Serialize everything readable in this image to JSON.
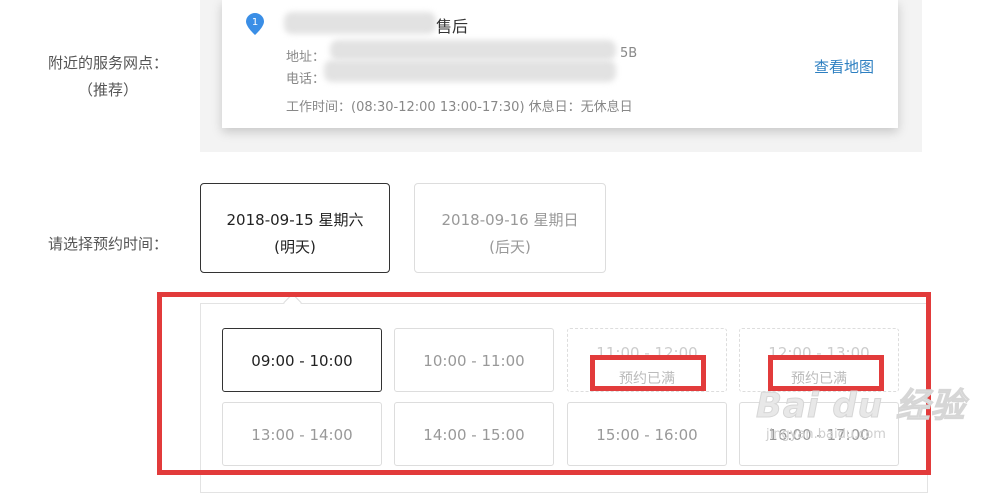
{
  "nearby": {
    "label_line1": "附近的服务网点：",
    "label_line2": "（推荐）"
  },
  "service_point": {
    "name_suffix": "售后",
    "address_label": "地址：",
    "address_tail": "5B",
    "phone_label": "电话：",
    "hours": "工作时间：(08:30-12:00 13:00-17:30) 休息日：无休息日",
    "map_link": "查看地图"
  },
  "time_label": "请选择预约时间：",
  "dates": [
    {
      "date": "2018-09-15 星期六",
      "rel": "(明天)",
      "selected": true
    },
    {
      "date": "2018-09-16 星期日",
      "rel": "(后天)",
      "selected": false
    }
  ],
  "slots": [
    {
      "time": "09:00 - 10:00",
      "state": "selected"
    },
    {
      "time": "10:00 - 11:00",
      "state": "available"
    },
    {
      "time": "11:00 - 12:00",
      "state": "full",
      "status": "预约已满"
    },
    {
      "time": "12:00 - 13:00",
      "state": "full",
      "status": "预约已满"
    },
    {
      "time": "13:00 - 14:00",
      "state": "available"
    },
    {
      "time": "14:00 - 15:00",
      "state": "available"
    },
    {
      "time": "15:00 - 16:00",
      "state": "available"
    },
    {
      "time": "16:00 - 17:00",
      "state": "available"
    }
  ],
  "watermark": {
    "logo": "Bai du 经验",
    "url": "jingyan.baidu.com"
  },
  "colors": {
    "highlight": "#e23b3b",
    "link": "#2d7fc1",
    "pin": "#3a8ee6"
  }
}
